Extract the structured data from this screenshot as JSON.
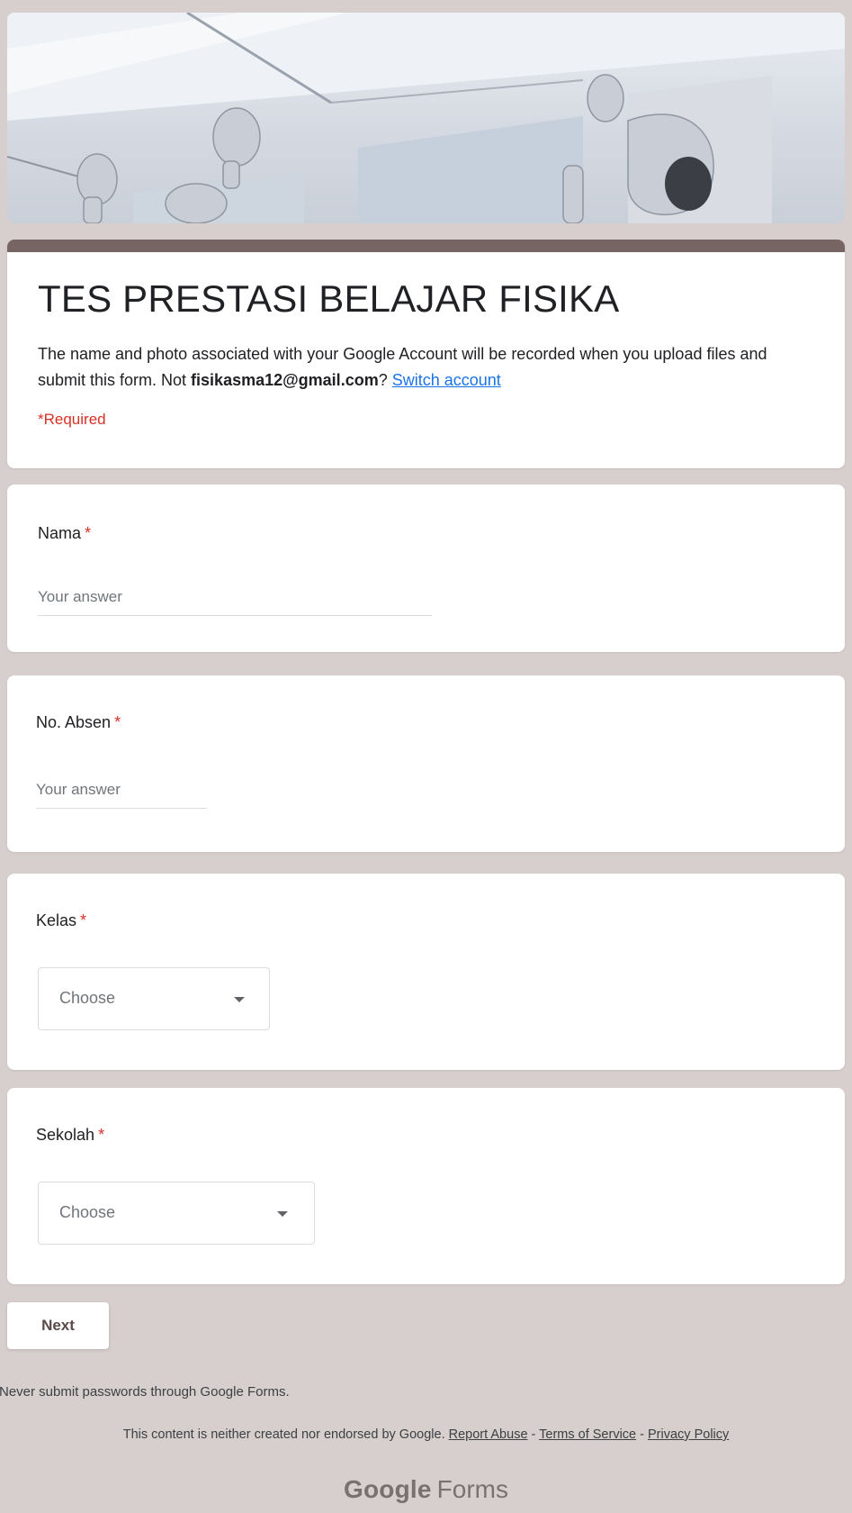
{
  "form": {
    "title": "TES PRESTASI BELAJAR FISIKA",
    "notice_prefix": "The name and photo associated with your Google Account will be recorded when you upload files and submit this form. Not ",
    "account_email": "fisikasma12@gmail.com",
    "notice_suffix": "?",
    "switch_account": "Switch account",
    "required_note": "*Required",
    "accent_color": "#776564",
    "background_color": "#d7cfcd"
  },
  "questions": [
    {
      "label": "Nama",
      "required_mark": "*",
      "placeholder": "Your answer"
    },
    {
      "label": "No. Absen",
      "required_mark": "*",
      "placeholder": "Your answer"
    },
    {
      "label": "Kelas",
      "required_mark": "*",
      "selected": "Choose"
    },
    {
      "label": "Sekolah",
      "required_mark": "*",
      "selected": "Choose"
    }
  ],
  "actions": {
    "next_label": "Next"
  },
  "footer": {
    "password_warning": "Never submit passwords through Google Forms.",
    "disclaimer": "This content is neither created nor endorsed by Google.",
    "report_abuse": "Report Abuse",
    "sep1": " - ",
    "terms": "Terms of Service",
    "sep2": " - ",
    "privacy": "Privacy Policy",
    "brand_google": "Google",
    "brand_forms": "Forms"
  }
}
